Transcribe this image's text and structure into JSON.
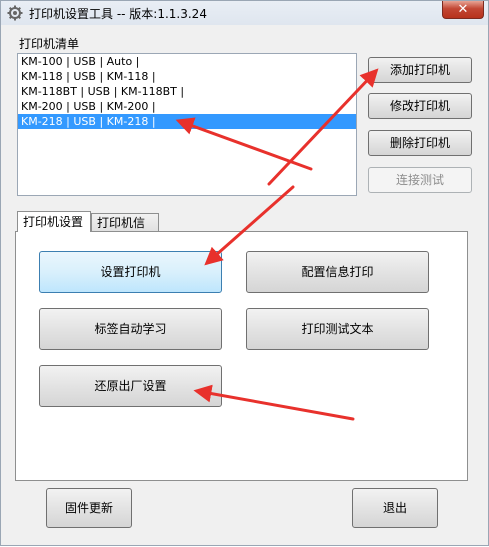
{
  "window": {
    "title": "打印机设置工具 -- 版本:1.1.3.24",
    "close_glyph": "✕"
  },
  "printer_list": {
    "label": "打印机清单",
    "items": [
      "KM-100 | USB | Auto |",
      "KM-118 | USB | KM-118 |",
      "KM-118BT | USB | KM-118BT |",
      "KM-200 | USB | KM-200 |",
      "KM-218 | USB | KM-218 |"
    ],
    "selected_index": 4
  },
  "side_buttons": {
    "add": "添加打印机",
    "modify": "修改打印机",
    "delete": "删除打印机",
    "test": "连接测试"
  },
  "tabs": [
    {
      "label": "打印机设置",
      "active": true
    },
    {
      "label": "打印机信息",
      "active": false
    }
  ],
  "panel_buttons": {
    "setup_printer": "设置打印机",
    "config_print": "配置信息打印",
    "label_learn": "标签自动学习",
    "print_test_text": "打印测试文本",
    "factory_reset": "还原出厂设置"
  },
  "bottom_buttons": {
    "firmware": "固件更新",
    "exit": "退出"
  },
  "colors": {
    "selection": "#3399ff",
    "annotation_arrow": "#e8312c"
  }
}
